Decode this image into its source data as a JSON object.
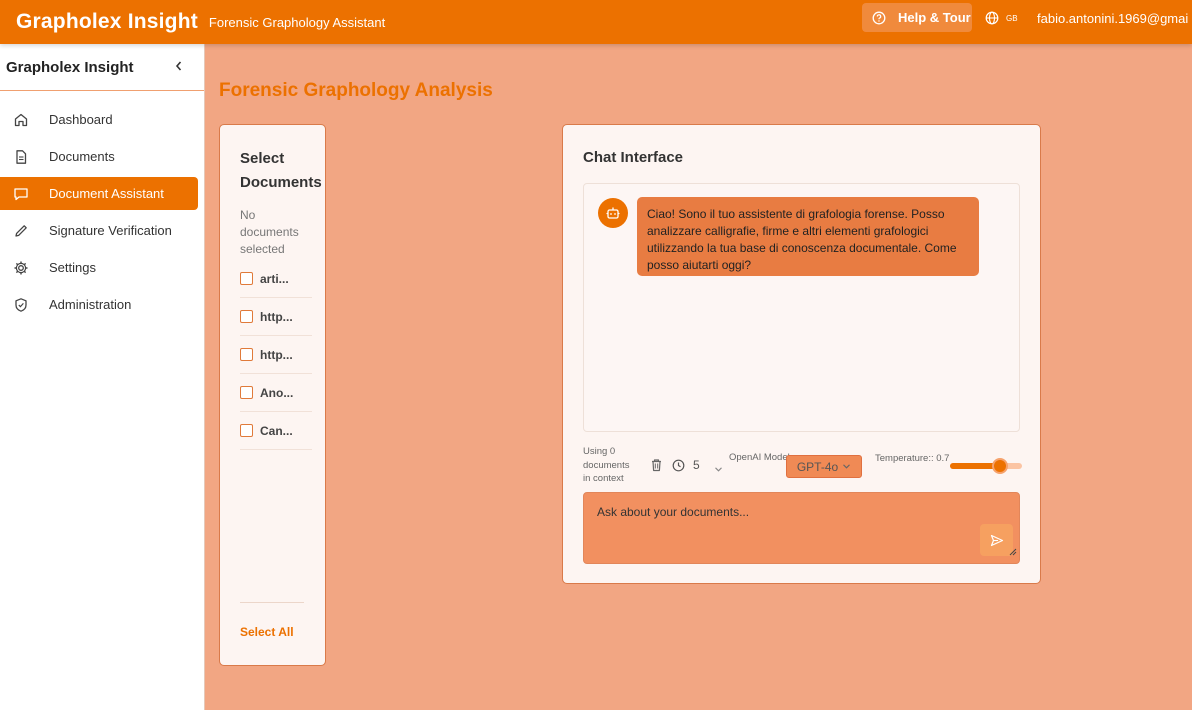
{
  "header": {
    "brand": "Grapholex Insight",
    "subtitle": "Forensic Graphology Assistant",
    "help_label": "Help & Tour",
    "lang_code": "GB",
    "user_email": "fabio.antonini.1969@gmai"
  },
  "sidebar": {
    "title": "Grapholex Insight",
    "collapse_icon": "chevron-left-icon",
    "items": [
      {
        "label": "Dashboard",
        "icon": "home-icon",
        "active": false
      },
      {
        "label": "Documents",
        "icon": "document-icon",
        "active": false
      },
      {
        "label": "Document Assistant",
        "icon": "chat-icon",
        "active": true
      },
      {
        "label": "Signature Verification",
        "icon": "pen-icon",
        "active": false
      },
      {
        "label": "Settings",
        "icon": "gear-icon",
        "active": false
      },
      {
        "label": "Administration",
        "icon": "shield-icon",
        "active": false
      }
    ]
  },
  "main": {
    "page_title": "Forensic Graphology Analysis"
  },
  "documents": {
    "title": "Select Documents",
    "empty_text": "No documents selected",
    "items": [
      "arti...",
      "http...",
      "http...",
      "Ano...",
      "Can..."
    ],
    "select_all": "Select All"
  },
  "chat": {
    "title": "Chat Interface",
    "bot_message": "Ciao! Sono il tuo assistente di grafologia forense. Posso analizzare calligrafie, firme e altri elementi grafologici utilizzando la tua base di conoscenza documentale. Come posso aiutarti oggi?",
    "context_info": "Using 0 documents in context",
    "history_count": "5",
    "model_label": "OpenAI Model:",
    "model_value": "GPT-4o",
    "temperature_label": "Temperature:: 0.7",
    "temperature_value": 0.7,
    "input_placeholder": "Ask about your documents..."
  },
  "colors": {
    "accent": "#ec7100",
    "background": "#f2a683",
    "bubble": "#e87c42"
  }
}
